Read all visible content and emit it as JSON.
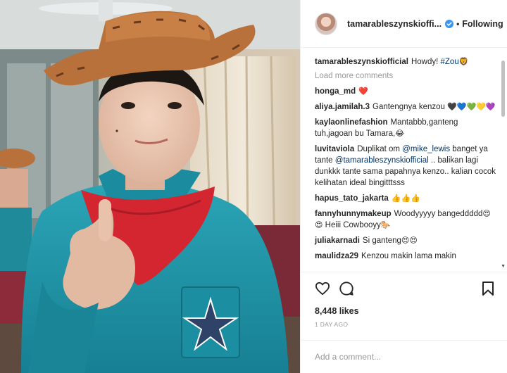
{
  "post": {
    "owner": "tamarableszynskiofficial",
    "owner_display": "tamarableszynskioffi...",
    "dot": "•",
    "follow_label": "Following",
    "caption": {
      "user": "tamarableszynskiofficial",
      "text": "Howdy! ",
      "hashtag": "#Zou",
      "emoji": "🦁"
    },
    "load_more": "Load more comments",
    "comments": [
      {
        "user": "honga_md",
        "text": "",
        "emoji": "❤️"
      },
      {
        "user": "aliya.jamilah.3",
        "text": "Gantengnya kenzou ",
        "emoji": "🖤💙💚💛💜"
      },
      {
        "user": "kaylaonlinefashion",
        "text": "Mantabbb,ganteng tuh,jagoan bu Tamara,",
        "emoji": "😂"
      },
      {
        "user": "luvitaviola",
        "text_before": "Duplikat om ",
        "mention1": "@mike_lewis",
        "text_mid": " banget ya tante ",
        "mention2": "@tamarableszynskiofficial",
        "text_after": " .. balikan lagi dunkkk tante sama papahnya kenzo.. kalian cocok kelihatan ideal bingitttsss"
      },
      {
        "user": "hapus_tato_jakarta",
        "text": "",
        "emoji": "👍👍👍"
      },
      {
        "user": "fannyhunnymakeup",
        "text": "Woodyyyyy bangeddddd",
        "emoji": "😍😍",
        "text2": " Heiii Cowbooyy",
        "emoji2": "🐎"
      },
      {
        "user": "juliakarnadi",
        "text": "Si ganteng",
        "emoji": "😍😍"
      },
      {
        "user": "maulidza29",
        "text": "Kenzou makin lama makin",
        "emoji": ""
      }
    ],
    "likes": "8,448 likes",
    "time": "1 DAY AGO",
    "add_comment_placeholder": "Add a comment..."
  },
  "icons": {
    "verified": "verified-badge-icon",
    "like": "heart-outline-icon",
    "comment": "comment-bubble-icon",
    "save": "bookmark-icon",
    "scroll_down": "scroll-down-arrow-icon"
  },
  "colors": {
    "verified": "#3897f0",
    "link": "#003569",
    "muted": "#999999",
    "text": "#262626",
    "shirt": "#1e8fa3",
    "bandana": "#d32630",
    "hat": "#b8713a"
  }
}
